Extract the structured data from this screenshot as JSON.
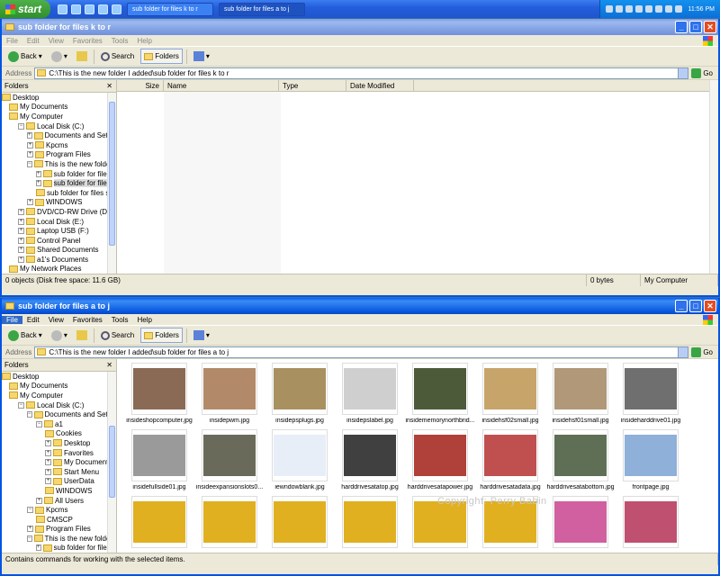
{
  "taskbar": {
    "start_label": "start",
    "tasks": [
      "sub folder for files k to r",
      "sub folder for files a to j"
    ],
    "clock": "11:56 PM"
  },
  "top": {
    "title": "sub folder for files k to r",
    "menu": [
      "File",
      "Edit",
      "View",
      "Favorites",
      "Tools",
      "Help"
    ],
    "back_label": "Back",
    "search_label": "Search",
    "folders_label": "Folders",
    "address_label": "Address",
    "address_value": "C:\\This is the new folder I added\\sub folder for files k to r",
    "go_label": "Go",
    "folders_pane_title": "Folders",
    "columns": [
      "Size",
      "Name",
      "Type",
      "Date Modified"
    ],
    "status": {
      "left": "0 objects (Disk free space: 11.6 GB)",
      "size": "0 bytes",
      "location": "My Computer"
    },
    "tree": [
      "Desktop",
      "My Documents",
      "My Computer",
      "Local Disk (C:)",
      "Documents and Settings",
      "Kpcms",
      "Program Files",
      "This is the new folder I added",
      "sub folder for files a to j",
      "sub folder for files k to r",
      "sub folder for files s to z",
      "WINDOWS",
      "DVD/CD-RW Drive (D:)",
      "Local Disk (E:)",
      "Laptop USB (F:)",
      "Control Panel",
      "Shared Documents",
      "a1's Documents",
      "My Network Places"
    ]
  },
  "bottom": {
    "title": "sub folder for files a to j",
    "menu": [
      "File",
      "Edit",
      "View",
      "Favorites",
      "Tools",
      "Help"
    ],
    "back_label": "Back",
    "search_label": "Search",
    "folders_label": "Folders",
    "address_label": "Address",
    "address_value": "C:\\This is the new folder I added\\sub folder for files a to j",
    "go_label": "Go",
    "folders_pane_title": "Folders",
    "status": {
      "left": "Contains commands for working with the selected items."
    },
    "watermark": "Copyright: Perry Babin",
    "tree": [
      "Desktop",
      "My Documents",
      "My Computer",
      "Local Disk (C:)",
      "Documents and Settings",
      "a1",
      "Cookies",
      "Desktop",
      "Favorites",
      "My Documents",
      "Start Menu",
      "UserData",
      "WINDOWS",
      "All Users",
      "Kpcms",
      "CMSCP",
      "Program Files",
      "This is the new folder I added",
      "sub folder for files a to"
    ],
    "files": [
      "insideshopcomputer.jpg",
      "insidepwm.jpg",
      "insidepsplugs.jpg",
      "insidepslabel.jpg",
      "insidememorynorthbrid...",
      "insidehsf02small.jpg",
      "insidehsf01small.jpg",
      "insideharddrive01.jpg",
      "insidefullside01.jpg",
      "insideexpansionslots0...",
      "iewndowblank.jpg",
      "harddrivesatatop.jpg",
      "harddrivesatapower.jpg",
      "harddrivesatadata.jpg",
      "harddrivesatabottom.jpg",
      "frontpage.jpg",
      "",
      "",
      "",
      "",
      "",
      "",
      "",
      ""
    ]
  },
  "colors": {
    "xp_blue": "#0054e3",
    "panel": "#ece9d8"
  }
}
